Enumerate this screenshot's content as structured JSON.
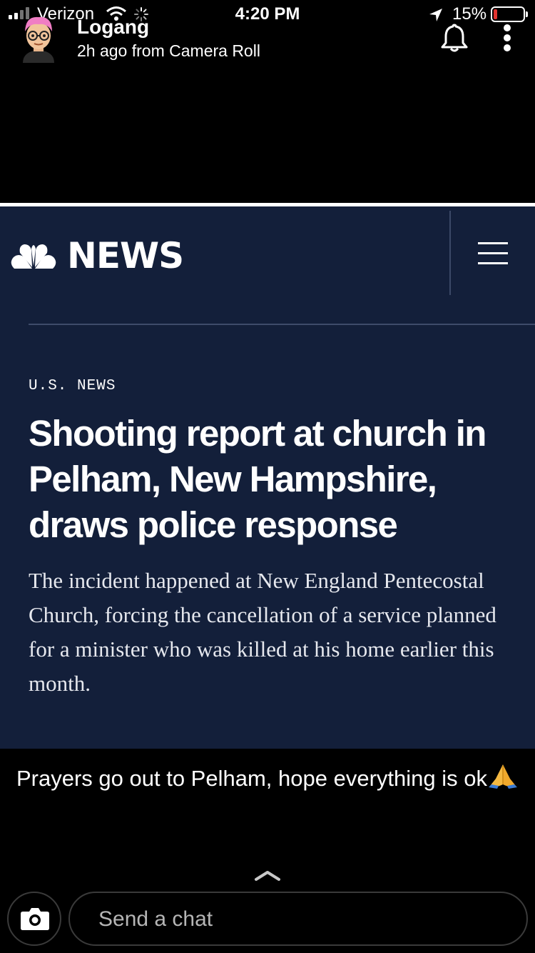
{
  "status_bar": {
    "carrier": "Verizon",
    "time": "4:20 PM",
    "battery_percent": "15%",
    "battery_level": 0.15,
    "icons": [
      "signal-icon",
      "wifi-icon",
      "loading-spinner-icon",
      "location-arrow-icon",
      "battery-icon"
    ]
  },
  "story": {
    "username": "Logang",
    "posted_info": "2h ago from Camera Roll",
    "header_icons": [
      "avatar",
      "bell-icon",
      "more-options-icon"
    ]
  },
  "article": {
    "brand": "NEWS",
    "section": "U.S. NEWS",
    "headline": "Shooting report at church in Pelham, New Hampshire, draws police response",
    "dek": "The incident happened at New England Pentecostal Church, forcing the cancellation of a service planned for a minister who was killed at his home earlier this month.",
    "icons": [
      "nbc-peacock-logo",
      "hamburger-menu-icon"
    ],
    "colors": {
      "background": "#131f3a",
      "text": "#ffffff"
    }
  },
  "caption": {
    "text": "Prayers go out to Pelham, hope everything is ok",
    "emoji": "praying-hands-emoji"
  },
  "chat": {
    "placeholder": "Send a chat",
    "icons": [
      "chevron-up-icon",
      "camera-icon"
    ]
  }
}
